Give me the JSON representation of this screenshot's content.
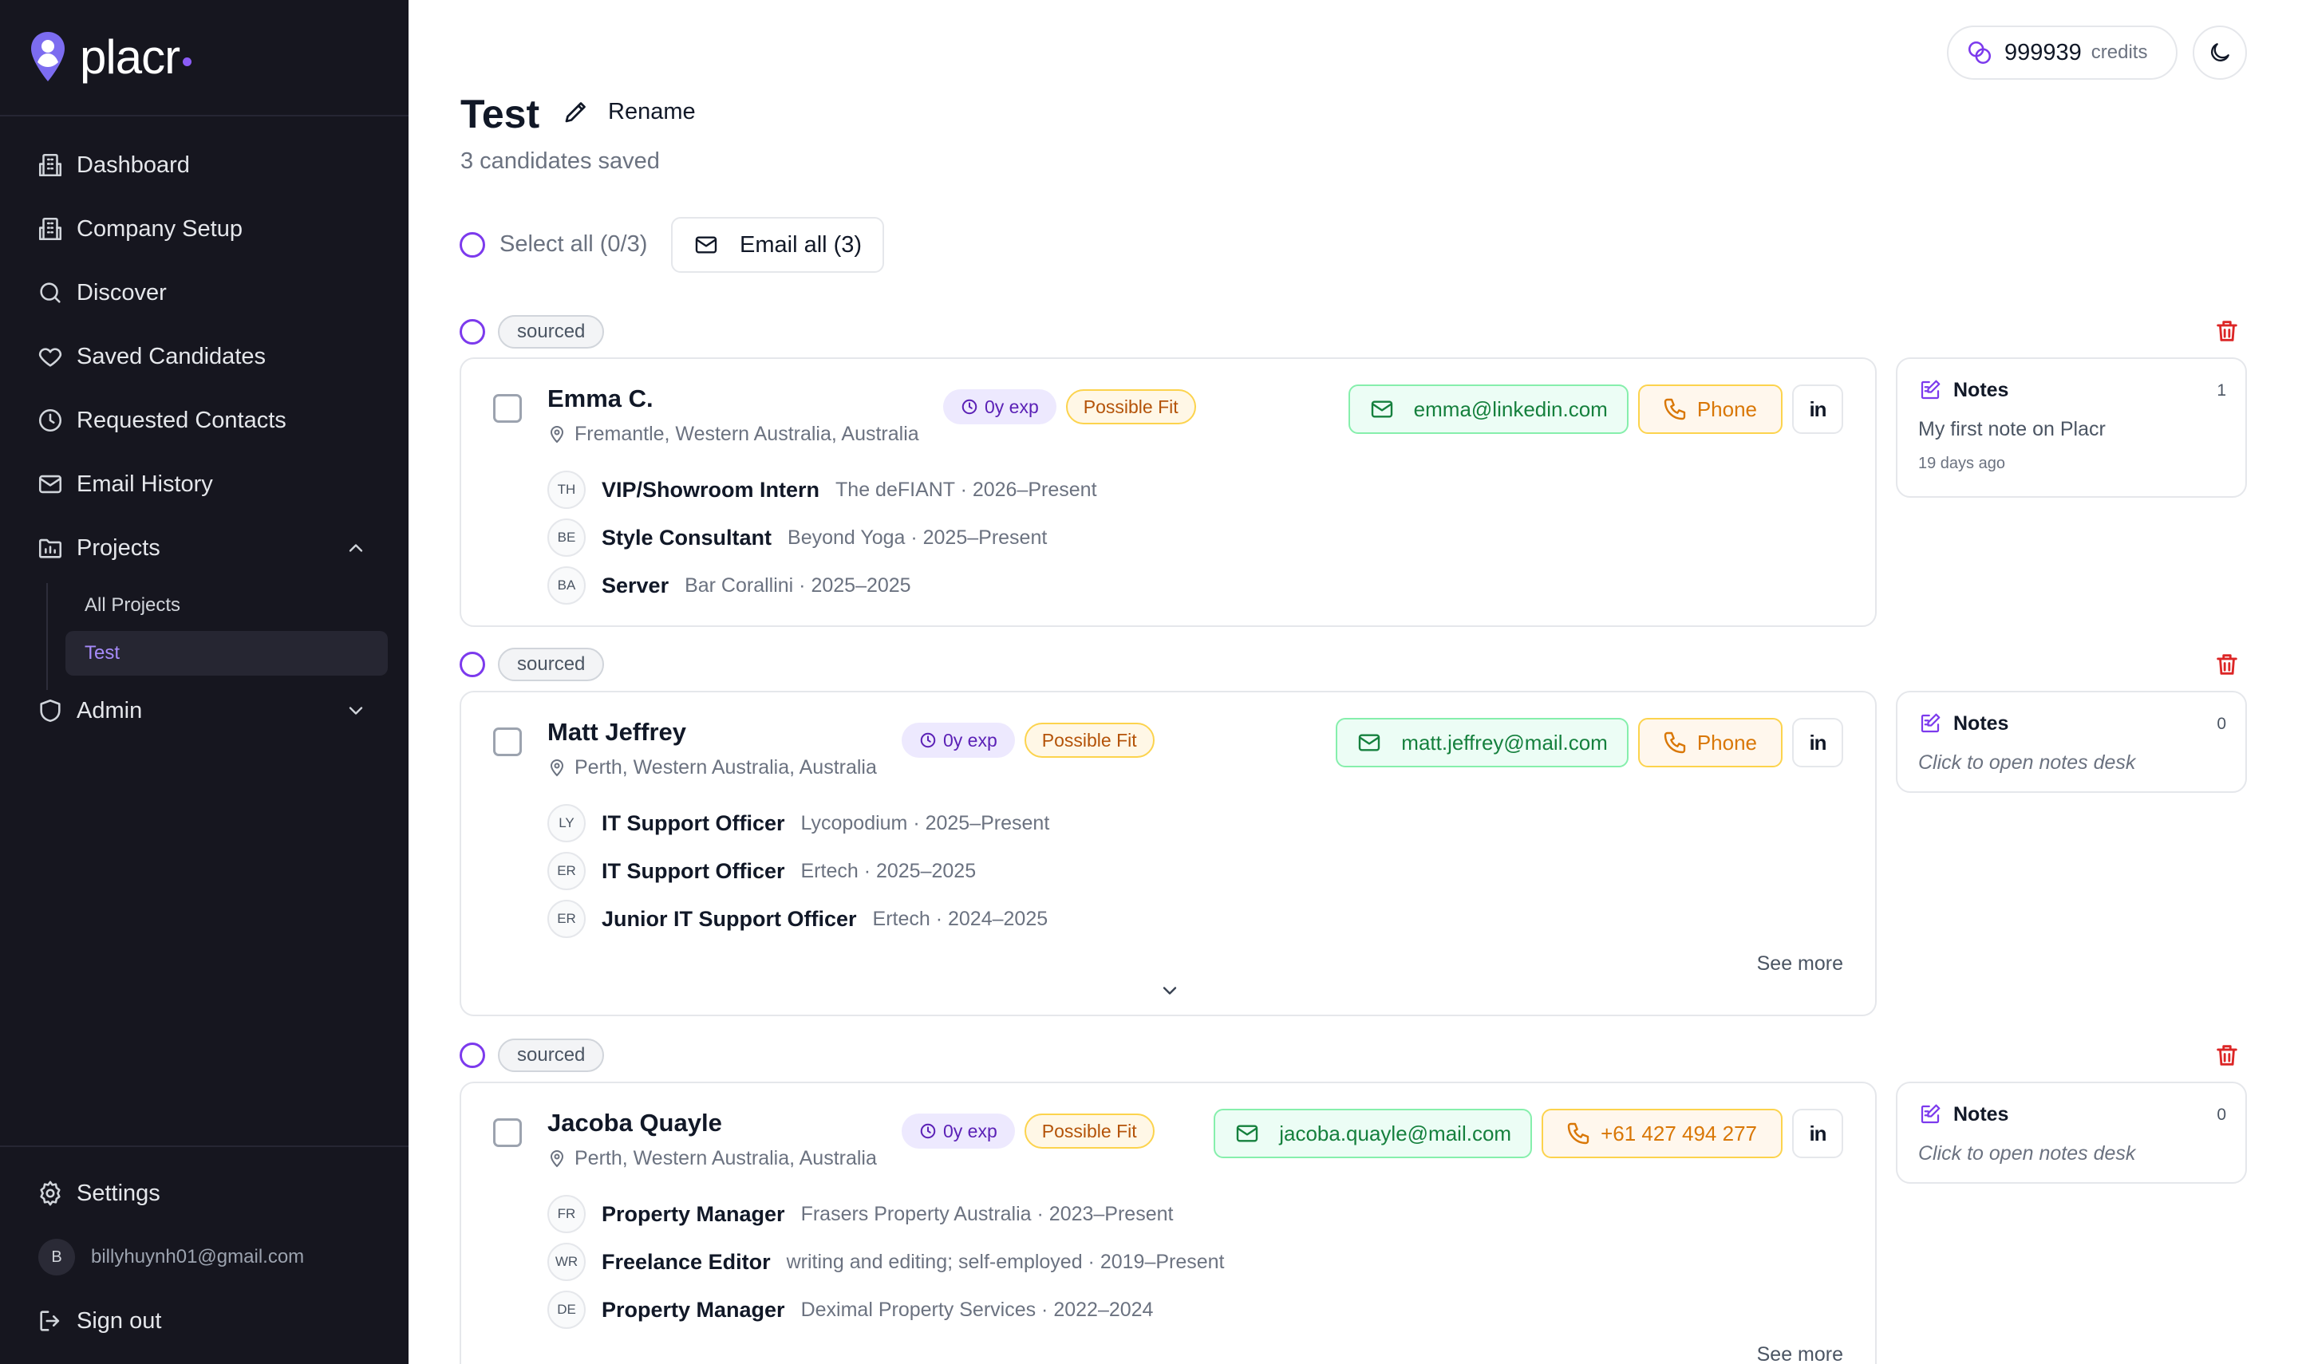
{
  "brand": {
    "name": "placr",
    "accent": "#8b5cf6"
  },
  "sidebar": {
    "items": [
      {
        "label": "Dashboard",
        "icon": "building-icon"
      },
      {
        "label": "Company Setup",
        "icon": "building-icon"
      },
      {
        "label": "Discover",
        "icon": "search-icon"
      },
      {
        "label": "Saved Candidates",
        "icon": "heart-icon"
      },
      {
        "label": "Requested Contacts",
        "icon": "clock-icon"
      },
      {
        "label": "Email History",
        "icon": "mail-icon"
      },
      {
        "label": "Projects",
        "icon": "folder-chart-icon",
        "expanded": true
      },
      {
        "label": "Admin",
        "icon": "shield-icon",
        "expanded": false
      }
    ],
    "project_sub": [
      {
        "label": "All Projects",
        "active": false
      },
      {
        "label": "Test",
        "active": true
      }
    ],
    "settings_label": "Settings",
    "user": {
      "initial": "B",
      "email": "billyhuynh01@gmail.com"
    },
    "signout_label": "Sign out"
  },
  "topbar": {
    "credits_value": "999939",
    "credits_label": "credits",
    "theme_icon": "moon-icon"
  },
  "header": {
    "title": "Test",
    "rename_label": "Rename",
    "subtitle": "3 candidates saved",
    "select_all_label": "Select all (0/3)",
    "email_all_label": "Email all (3)"
  },
  "candidates": [
    {
      "status": "sourced",
      "name": "Emma C.",
      "location": "Fremantle, Western Australia, Australia",
      "exp_badge": "0y exp",
      "fit_badge": "Possible Fit",
      "email": "emma@linkedin.com",
      "phone": "Phone",
      "linkedin": "in",
      "experience": [
        {
          "initials": "TH",
          "title": "VIP/Showroom Intern",
          "meta": "The deFIANT · 2026–Present"
        },
        {
          "initials": "BE",
          "title": "Style Consultant",
          "meta": "Beyond Yoga · 2025–Present"
        },
        {
          "initials": "BA",
          "title": "Server",
          "meta": "Bar Corallini · 2025–2025"
        }
      ],
      "see_more": "",
      "notes": {
        "title": "Notes",
        "count": "1",
        "text": "My first note on Placr",
        "time": "19 days ago"
      }
    },
    {
      "status": "sourced",
      "name": "Matt Jeffrey",
      "location": "Perth, Western Australia, Australia",
      "exp_badge": "0y exp",
      "fit_badge": "Possible Fit",
      "email": "matt.jeffrey@mail.com",
      "phone": "Phone",
      "linkedin": "in",
      "experience": [
        {
          "initials": "LY",
          "title": "IT Support Officer",
          "meta": "Lycopodium · 2025–Present"
        },
        {
          "initials": "ER",
          "title": "IT Support Officer",
          "meta": "Ertech · 2025–2025"
        },
        {
          "initials": "ER",
          "title": "Junior IT Support Officer",
          "meta": "Ertech · 2024–2025"
        }
      ],
      "see_more": "See more",
      "notes": {
        "title": "Notes",
        "count": "0",
        "text": "Click to open notes desk",
        "time": ""
      }
    },
    {
      "status": "sourced",
      "name": "Jacoba Quayle",
      "location": "Perth, Western Australia, Australia",
      "exp_badge": "0y exp",
      "fit_badge": "Possible Fit",
      "email": "jacoba.quayle@mail.com",
      "phone": "+61 427 494 277",
      "linkedin": "in",
      "experience": [
        {
          "initials": "FR",
          "title": "Property Manager",
          "meta": "Frasers Property Australia · 2023–Present"
        },
        {
          "initials": "WR",
          "title": "Freelance Editor",
          "meta": "writing and editing; self-employed · 2019–Present"
        },
        {
          "initials": "DE",
          "title": "Property Manager",
          "meta": "Deximal Property Services · 2022–2024"
        }
      ],
      "see_more": "See more",
      "notes": {
        "title": "Notes",
        "count": "0",
        "text": "Click to open notes desk",
        "time": ""
      }
    }
  ]
}
